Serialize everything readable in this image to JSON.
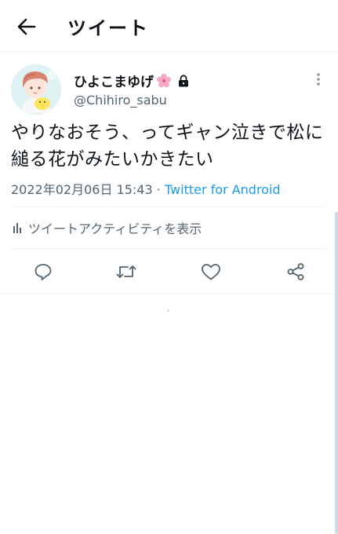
{
  "header": {
    "title": "ツイート"
  },
  "tweet": {
    "display_name": "ひよこまゆげ",
    "handle": "@Chihiro_sabu",
    "text": "やりなおそう、ってギャン泣きで松に縋る花がみたいかきたい",
    "timestamp": "2022年02月06日 15:43",
    "separator": " · ",
    "source": "Twitter for Android"
  },
  "activity": {
    "label": "ツイートアクティビティを表示"
  },
  "actions": {
    "reply_icon": "reply-icon",
    "retweet_icon": "retweet-icon",
    "like_icon": "heart-icon",
    "share_icon": "share-icon"
  },
  "colors": {
    "link": "#1d9bf0",
    "secondary_text": "#536471",
    "divider": "#eff3f4"
  }
}
